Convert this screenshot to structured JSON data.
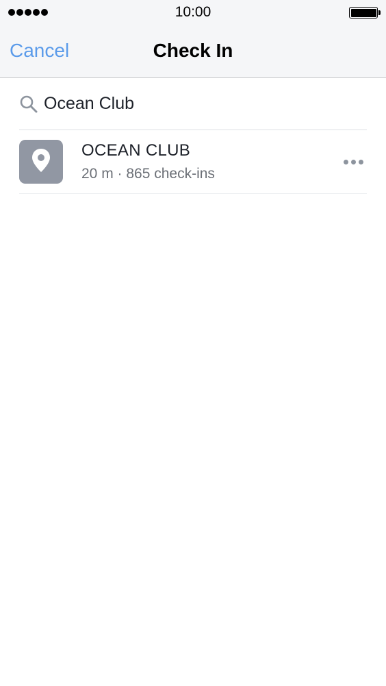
{
  "status_bar": {
    "time": "10:00",
    "signal_icon": "signal-dots-icon",
    "battery_icon": "battery-icon",
    "battery_level": 1.0
  },
  "nav": {
    "cancel_label": "Cancel",
    "title": "Check In"
  },
  "search": {
    "icon": "search-icon",
    "value": "Ocean Club"
  },
  "results": [
    {
      "name": "OCEAN CLUB",
      "meta": "20 m · 865 check-ins",
      "icon": "location-pin-icon",
      "more_icon": "more-options-icon"
    }
  ],
  "colors": {
    "accent": "#5b9bea",
    "bar_bg": "#f5f6f8",
    "thumb_bg": "#9197a3",
    "secondary_text": "#6b6f76"
  }
}
